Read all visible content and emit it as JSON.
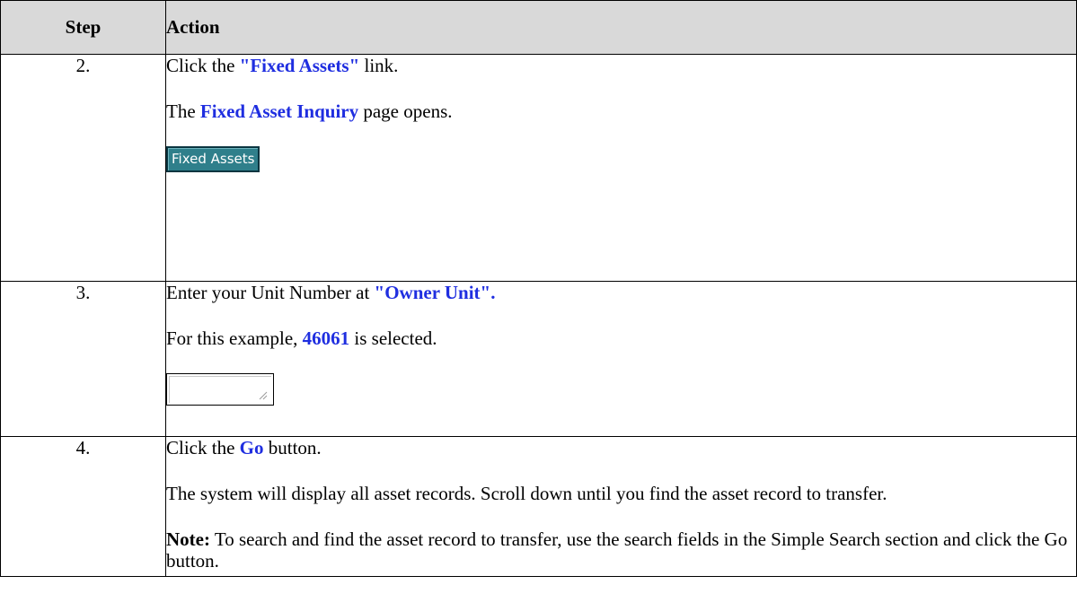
{
  "table": {
    "headers": {
      "step": "Step",
      "action": "Action"
    },
    "rows": [
      {
        "step": "2.",
        "line1_pre": "Click the ",
        "line1_hl": "\"Fixed Assets\"",
        "line1_post": " link.",
        "line2_pre": "The ",
        "line2_hl": "Fixed Asset Inquiry",
        "line2_post": " page opens.",
        "button_label": "Fixed Assets"
      },
      {
        "step": "3.",
        "line1_pre": "Enter your Unit Number at ",
        "line1_hl": "\"Owner Unit\".",
        "line2_pre": "For this example, ",
        "line2_hl": "46061",
        "line2_post": " is selected.",
        "field_value": ""
      },
      {
        "step": "4.",
        "line1_pre": "Click the ",
        "line1_hl": "Go",
        "line1_post": " button.",
        "line2": "The system will display all asset records. Scroll down until you find the asset record to transfer.",
        "note_label": "Note:",
        "note_text": " To search and find the asset record to transfer, use the search fields in the Simple Search section and click the Go button."
      }
    ]
  },
  "colors": {
    "highlight": "#1f2ee0",
    "header_bg": "#d9d9d9",
    "button_bg": "#2f7f8b"
  }
}
